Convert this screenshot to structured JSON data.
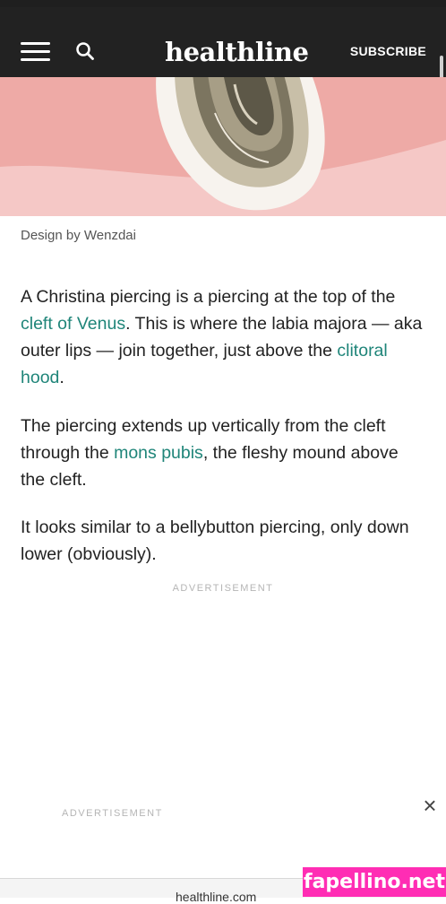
{
  "header": {
    "logo": "healthline",
    "subscribe_label": "SUBSCRIBE",
    "menu_icon": "hamburger-menu-icon",
    "search_icon": "search-icon",
    "background": "#222222"
  },
  "hero": {
    "background": "#f5c8c6",
    "caption": "Design by Wenzdai"
  },
  "article": {
    "p1": {
      "t1": "A Christina piercing is a piercing at the top of the ",
      "link1": "cleft of Venus",
      "t2": ". This is where the labia majora — aka outer lips — join together, just above the ",
      "link2": "clitoral hood",
      "t3": "."
    },
    "p2": {
      "t1": "The piercing extends up vertically from the cleft through the ",
      "link1": "mons pubis",
      "t2": ", the fleshy mound above the cleft."
    },
    "p3": {
      "t1": "It looks similar to a bellybutton piercing, only down lower (obviously)."
    },
    "link_color": "#1f8579"
  },
  "ads": {
    "label_top": "ADVERTISEMENT",
    "label_bottom": "ADVERTISEMENT",
    "close_icon": "close-icon"
  },
  "browser": {
    "url": "healthline.com"
  },
  "watermark": {
    "text": "fapellino.net",
    "color": "#ff2db4"
  }
}
